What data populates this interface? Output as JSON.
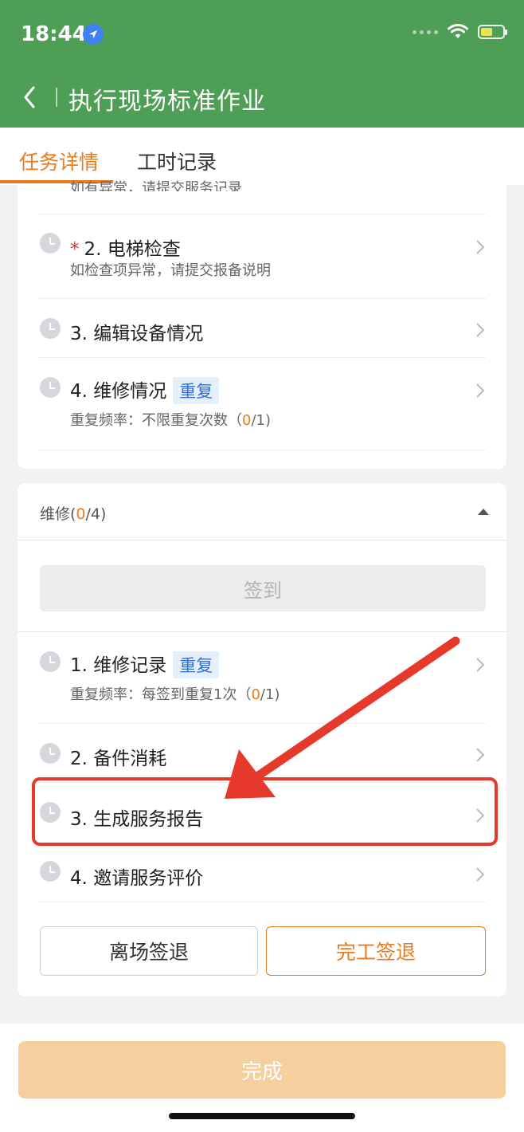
{
  "status_bar": {
    "time": "18:44"
  },
  "header": {
    "title": "执行现场标准作业"
  },
  "tabs": [
    {
      "label": "任务详情",
      "active": true
    },
    {
      "label": "工时记录",
      "active": false
    }
  ],
  "section1": {
    "partial_text": "如有异常，请提交服务记录",
    "items": [
      {
        "title": "2. 电梯检查",
        "required_mark": "*",
        "subtitle": "如检查项异常，请提交报备说明"
      },
      {
        "title": "3. 编辑设备情况"
      },
      {
        "title": "4. 维修情况",
        "tag": "重复",
        "subtitle_prefix": "重复频率：不限重复次数（",
        "count": "0",
        "subtitle_suffix": "/1)"
      }
    ]
  },
  "section2": {
    "label_prefix": "维修(",
    "label_count": "0",
    "label_suffix": "/4)",
    "checkin_label": "签到",
    "items": [
      {
        "title": "1. 维修记录",
        "tag": "重复",
        "subtitle_prefix": "重复频率：每签到重复1次（",
        "count": "0",
        "subtitle_suffix": "/1)"
      },
      {
        "title": "2. 备件消耗"
      },
      {
        "title": "3. 生成服务报告"
      },
      {
        "title": "4. 邀请服务评价"
      }
    ],
    "leave_button": "离场签退",
    "finish_button": "完工签退"
  },
  "footer": {
    "done_button": "完成"
  },
  "colors": {
    "header_green": "#4e9e55",
    "accent_orange": "#ea7a1e",
    "tag_blue": "#2f6fd6",
    "highlight_red": "#e5392b"
  }
}
